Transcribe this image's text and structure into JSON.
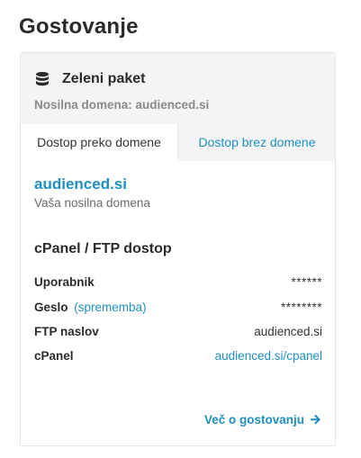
{
  "page": {
    "title": "Gostovanje"
  },
  "package": {
    "icon": "database-icon",
    "name": "Zeleni paket",
    "primary_domain_text": "Nosilna domena: audienced.si"
  },
  "tabs": [
    {
      "label": "Dostop preko domene",
      "active": true
    },
    {
      "label": "Dostop brez domene",
      "active": false
    }
  ],
  "domain": {
    "name": "audienced.si",
    "subtitle": "Vaša nosilna domena"
  },
  "access": {
    "title": "cPanel / FTP dostop",
    "rows": [
      {
        "label": "Uporabnik",
        "value": "******"
      },
      {
        "label": "Geslo",
        "change_label": "(sprememba)",
        "value": "********"
      },
      {
        "label": "FTP naslov",
        "value": "audienced.si"
      },
      {
        "label": "cPanel",
        "value": "audienced.si/cpanel"
      }
    ]
  },
  "footer": {
    "more_label": "Več o gostovanju",
    "more_icon": "arrow-right-icon"
  },
  "colors": {
    "accent": "#1f8fc1",
    "header_bg": "#f4f4f4",
    "muted": "#8a8a8a"
  }
}
